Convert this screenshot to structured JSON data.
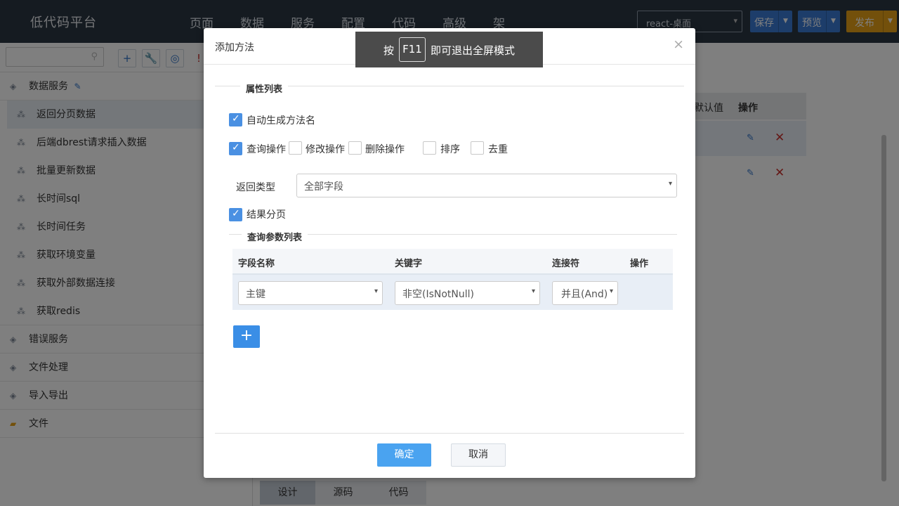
{
  "app": {
    "logo": "低代码平台",
    "nav": [
      "页面",
      "数据",
      "服务",
      "配置",
      "代码",
      "高级",
      "架"
    ],
    "env_select": "react-桌面",
    "save_label": "保存",
    "preview_label": "预览",
    "publish_label": "发布"
  },
  "sidebar": {
    "search_placeholder": "",
    "groups": [
      {
        "label": "数据服务"
      },
      {
        "label": "错误服务"
      },
      {
        "label": "文件处理"
      },
      {
        "label": "导入导出"
      },
      {
        "label": "文件"
      }
    ],
    "children": [
      {
        "label": "返回分页数据"
      },
      {
        "label": "后端dbrest请求插入数据"
      },
      {
        "label": "批量更新数据"
      },
      {
        "label": "长时间sql"
      },
      {
        "label": "长时间任务"
      },
      {
        "label": "获取环境变量"
      },
      {
        "label": "获取外部数据连接"
      },
      {
        "label": "获取redis"
      }
    ]
  },
  "background": {
    "col_default": "默认值",
    "col_action": "操作",
    "tabs": [
      "设计",
      "源码",
      "代码"
    ]
  },
  "fullscreen_toast": {
    "before": "按",
    "key": "F11",
    "after": "即可退出全屏模式"
  },
  "modal": {
    "title": "添加方法",
    "close": "×",
    "attr_legend": "属性列表",
    "auto_name_label": "自动生成方法名",
    "auto_name_checked": true,
    "ops": [
      {
        "label": "查询操作",
        "checked": true
      },
      {
        "label": "修改操作",
        "checked": false
      },
      {
        "label": "删除操作",
        "checked": false
      },
      {
        "label": "排序",
        "checked": false
      },
      {
        "label": "去重",
        "checked": false
      }
    ],
    "return_type_label": "返回类型",
    "return_type_value": "全部字段",
    "paging_label": "结果分页",
    "paging_checked": true,
    "query_legend": "查询参数列表",
    "table": {
      "headers": [
        "字段名称",
        "关键字",
        "连接符",
        "操作"
      ],
      "row": {
        "field": "主键",
        "keyword": "非空(IsNotNull)",
        "connector": "并且(And)"
      }
    },
    "add_icon": "+",
    "ok_label": "确定",
    "cancel_label": "取消"
  }
}
